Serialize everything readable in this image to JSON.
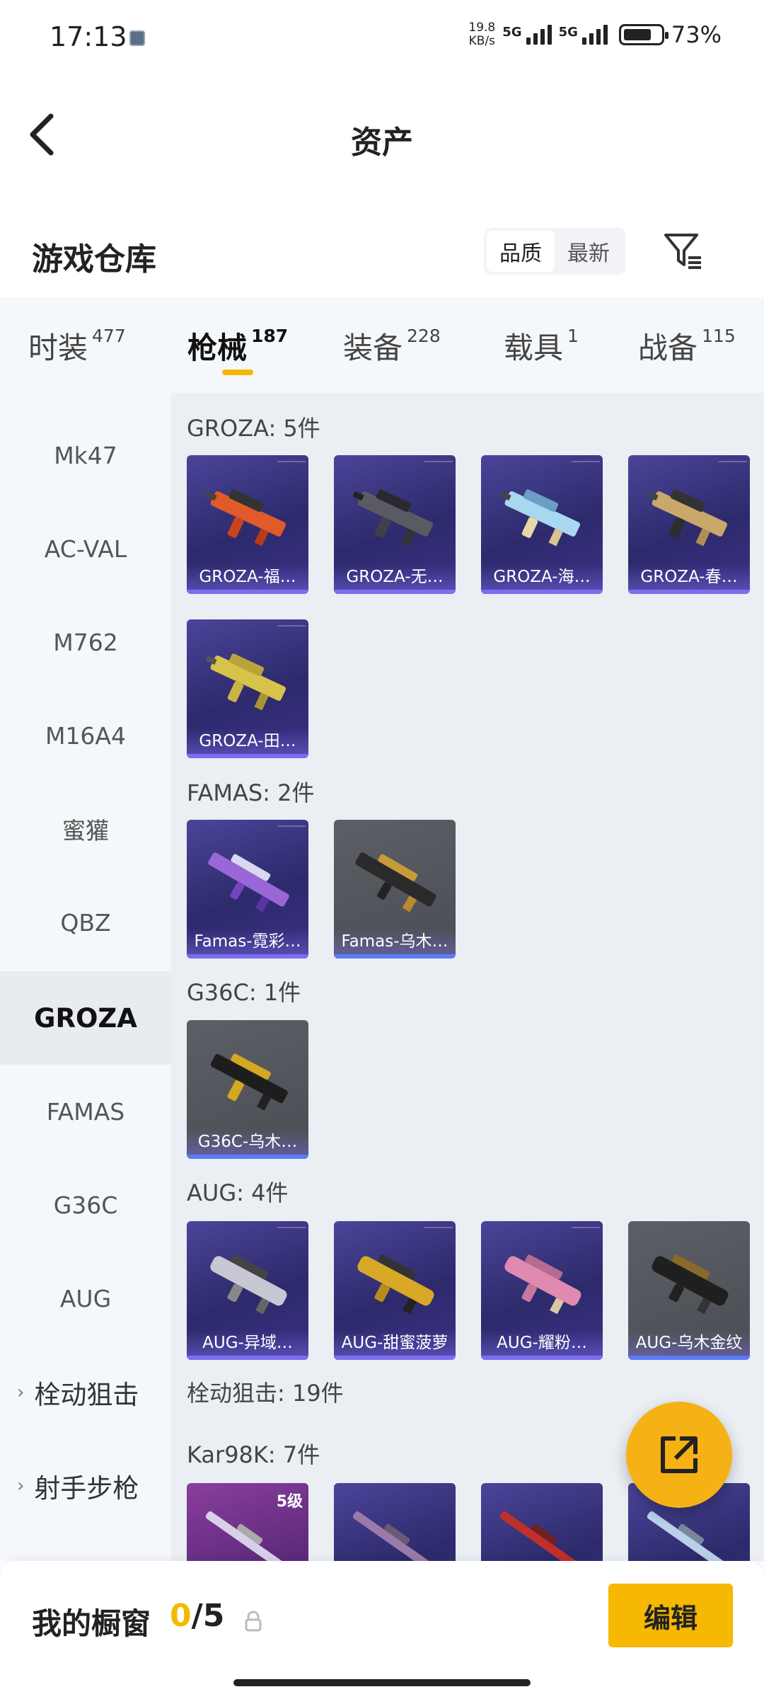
{
  "status": {
    "time": "17:13",
    "net_speed_value": "19.8",
    "net_speed_unit": "KB/s",
    "sim1_label": "5G",
    "sim2_label": "5G",
    "battery": "73%"
  },
  "header": {
    "title": "资产"
  },
  "warehouse": {
    "title": "游戏仓库",
    "sort_quality": "品质",
    "sort_newest": "最新"
  },
  "tabs": [
    {
      "label": "时装",
      "count": "477"
    },
    {
      "label": "枪械",
      "count": "187"
    },
    {
      "label": "装备",
      "count": "228"
    },
    {
      "label": "载具",
      "count": "1"
    },
    {
      "label": "战备",
      "count": "115"
    }
  ],
  "sidebar": {
    "items": [
      "Mk47",
      "AC-VAL",
      "M762",
      "M16A4",
      "蜜獾",
      "QBZ",
      "GROZA",
      "FAMAS",
      "G36C",
      "AUG",
      "栓动狙击",
      "射手步枪"
    ],
    "active": "GROZA"
  },
  "groups": [
    {
      "title": "GROZA: 5件",
      "items": [
        "GROZA-福…",
        "GROZA-无…",
        "GROZA-海…",
        "GROZA-春…",
        "GROZA-田…"
      ]
    },
    {
      "title": "FAMAS: 2件",
      "items": [
        "Famas-霓彩…",
        "Famas-乌木…"
      ]
    },
    {
      "title": "G36C: 1件",
      "items": [
        "G36C-乌木…"
      ]
    },
    {
      "title": "AUG: 4件",
      "items": [
        "AUG-异域…",
        "AUG-甜蜜菠萝",
        "AUG-耀粉…",
        "AUG-乌木金纹"
      ]
    },
    {
      "title": "栓动狙击: 19件"
    },
    {
      "title": "Kar98K: 7件",
      "level_badge": "5级"
    }
  ],
  "bottom": {
    "label": "我的橱窗",
    "current": "0",
    "total": "/5",
    "edit": "编辑"
  },
  "colors": {
    "accent": "#f5b800",
    "card_purple": "#2d2a6c",
    "card_gray": "#4b4d54"
  },
  "icons": {
    "back": "back-chevron-icon",
    "filter": "filter-icon",
    "share": "share-external-icon",
    "lock": "lock-icon"
  }
}
